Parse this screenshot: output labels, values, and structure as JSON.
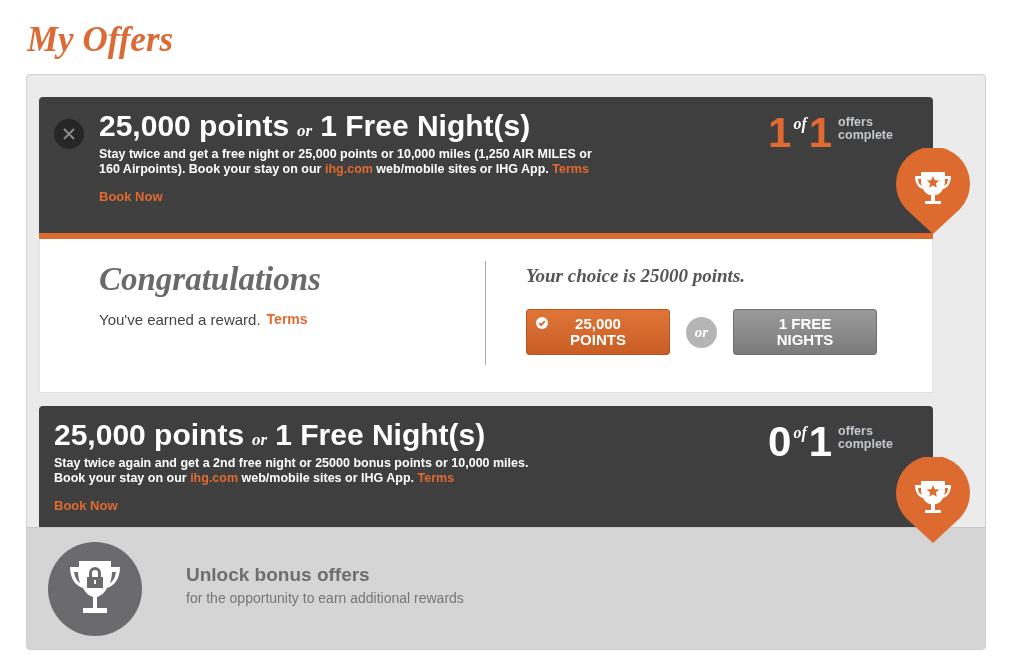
{
  "page_title": "My Offers",
  "offers": [
    {
      "dismissible": true,
      "points": "25,000 points",
      "or": "or",
      "nights": "1 Free Night(s)",
      "description": [
        {
          "kind": "text",
          "text": "Stay twice and get a free night or 25,000 points or 10,000 miles (1,250 AIR MILES or 160 Airpoints). Book your stay on our "
        },
        {
          "kind": "link",
          "text": "ihg.com"
        },
        {
          "kind": "text",
          "text": " web/mobile sites or IHG App. "
        },
        {
          "kind": "link",
          "text": "Terms"
        }
      ],
      "book": "Book Now",
      "progress": {
        "done": "1",
        "of": "of",
        "total": "1",
        "line1": "offers",
        "line2": "complete",
        "complete": true
      },
      "reward": {
        "heading": "Congratulations",
        "message": "You've earned a reward.",
        "terms": "Terms",
        "choice": "Your choice is 25000 points.",
        "or": "or",
        "options": [
          {
            "label": "25,000 POINTS",
            "selected": true
          },
          {
            "label": "1 FREE NIGHTS",
            "selected": false
          }
        ]
      }
    },
    {
      "dismissible": false,
      "points": "25,000 points",
      "or": "or",
      "nights": "1 Free Night(s)",
      "description": [
        {
          "kind": "text",
          "text": "Stay twice again and get a 2nd free night or 25000 bonus points or 10,000 miles. Book your stay on our "
        },
        {
          "kind": "link",
          "text": "ihg.com"
        },
        {
          "kind": "text",
          "text": " web/mobile sites or IHG App. "
        },
        {
          "kind": "link",
          "text": "Terms"
        }
      ],
      "book": "Book Now",
      "progress": {
        "done": "0",
        "of": "of",
        "total": "1",
        "line1": "offers",
        "line2": "complete",
        "complete": false
      }
    }
  ],
  "bonus": {
    "title": "Unlock bonus offers",
    "subtitle": "for the opportunity to earn additional rewards"
  }
}
